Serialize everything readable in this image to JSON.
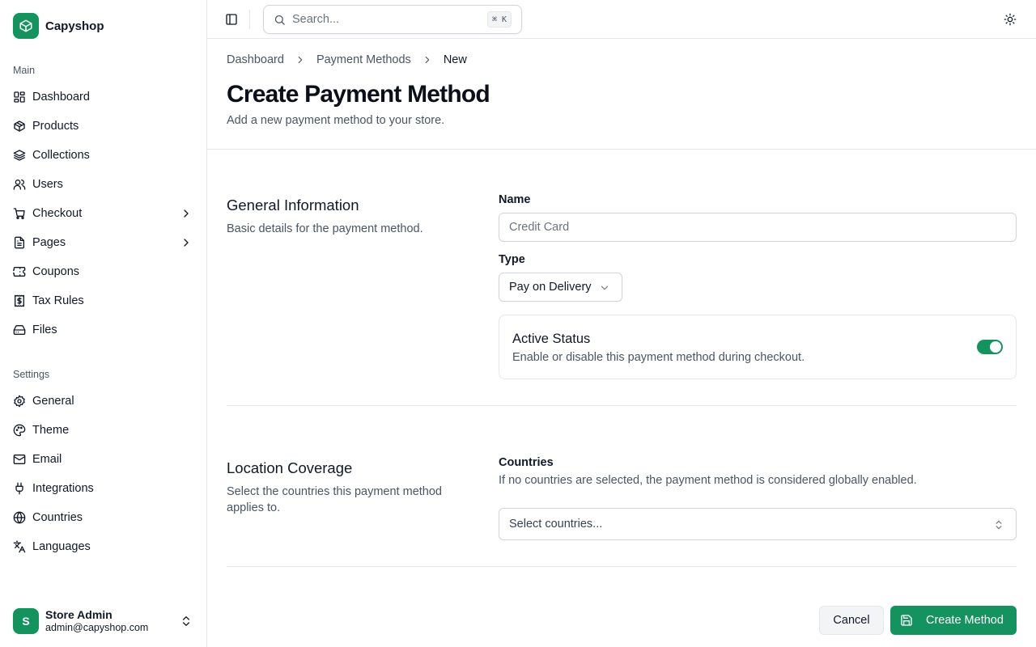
{
  "colors": {
    "accent": "#15935f",
    "border": "#e5e7eb",
    "muted_text": "#4b5563"
  },
  "brand": {
    "name": "Capyshop",
    "icon": "box-icon"
  },
  "sidebar": {
    "main_label": "Main",
    "main_items": [
      {
        "label": "Dashboard",
        "icon": "dashboard-icon"
      },
      {
        "label": "Products",
        "icon": "package-icon"
      },
      {
        "label": "Collections",
        "icon": "layers-icon"
      },
      {
        "label": "Users",
        "icon": "users-icon"
      },
      {
        "label": "Checkout",
        "icon": "cart-icon",
        "has_submenu": true
      },
      {
        "label": "Pages",
        "icon": "file-text-icon",
        "has_submenu": true
      },
      {
        "label": "Coupons",
        "icon": "ticket-icon"
      },
      {
        "label": "Tax Rules",
        "icon": "receipt-dollar-icon"
      },
      {
        "label": "Files",
        "icon": "hard-drive-icon"
      }
    ],
    "settings_label": "Settings",
    "settings_items": [
      {
        "label": "General",
        "icon": "settings-icon"
      },
      {
        "label": "Theme",
        "icon": "palette-icon"
      },
      {
        "label": "Email",
        "icon": "mail-icon"
      },
      {
        "label": "Integrations",
        "icon": "plug-icon"
      },
      {
        "label": "Countries",
        "icon": "globe-icon"
      },
      {
        "label": "Languages",
        "icon": "languages-icon"
      }
    ],
    "user": {
      "initial": "S",
      "name": "Store Admin",
      "email": "admin@capyshop.com"
    }
  },
  "topbar": {
    "search_placeholder": "Search...",
    "shortcut": "⌘ K"
  },
  "breadcrumb": [
    "Dashboard",
    "Payment Methods",
    "New"
  ],
  "page": {
    "title": "Create Payment Method",
    "subtitle": "Add a new payment method to your store."
  },
  "general": {
    "title": "General Information",
    "description": "Basic details for the payment method.",
    "name_label": "Name",
    "name_placeholder": "Credit Card",
    "name_value": "",
    "type_label": "Type",
    "type_value": "Pay on Delivery",
    "status_title": "Active Status",
    "status_description": "Enable or disable this payment method during checkout.",
    "status_enabled": true
  },
  "location": {
    "title": "Location Coverage",
    "description": "Select the countries this payment method applies to.",
    "countries_label": "Countries",
    "countries_hint": "If no countries are selected, the payment method is considered globally enabled.",
    "countries_placeholder": "Select countries..."
  },
  "actions": {
    "cancel": "Cancel",
    "create": "Create Method"
  }
}
